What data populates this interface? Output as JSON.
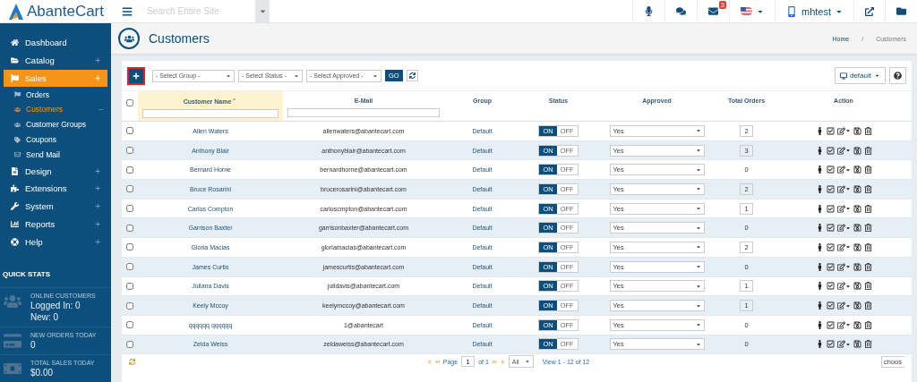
{
  "brand": "AbanteCart",
  "search": {
    "placeholder": "Search Entire Site"
  },
  "topbar": {
    "mail_badge": "3",
    "user": "mhtest"
  },
  "sidebar": {
    "items": [
      {
        "kind": "home",
        "label": "Dashboard",
        "selected": false
      },
      {
        "kind": "folder",
        "label": "Catalog",
        "selected": false,
        "toggle": "+"
      },
      {
        "kind": "flag",
        "label": "Sales",
        "selected": true,
        "toggle": "+",
        "children": [
          {
            "kind": "flag",
            "label": "Orders",
            "selected": false
          },
          {
            "kind": "users",
            "label": "Customers",
            "selected": true,
            "toggle": "−"
          },
          {
            "kind": "users",
            "label": "Customer Groups",
            "selected": false
          },
          {
            "kind": "tag",
            "label": "Coupons",
            "selected": false
          },
          {
            "kind": "mail",
            "label": "Send Mail",
            "selected": false
          }
        ]
      },
      {
        "kind": "file",
        "label": "Design",
        "selected": false,
        "toggle": "+"
      },
      {
        "kind": "puzzle",
        "label": "Extensions",
        "selected": false,
        "toggle": "+"
      },
      {
        "kind": "wrench",
        "label": "System",
        "selected": false,
        "toggle": "+"
      },
      {
        "kind": "chart",
        "label": "Reports",
        "selected": false,
        "toggle": "+"
      },
      {
        "kind": "help",
        "label": "Help",
        "selected": false,
        "toggle": "+"
      }
    ],
    "quick_stats": {
      "title": "QUICK STATS",
      "stats": [
        {
          "kind": "users",
          "label": "ONLINE CUSTOMERS",
          "lines": [
            "Logged In: 0",
            "New: 0"
          ]
        },
        {
          "kind": "card",
          "label": "NEW ORDERS TODAY",
          "lines": [
            "0"
          ]
        },
        {
          "kind": "money",
          "label": "TOTAL SALES TODAY",
          "lines": [
            "$0.00"
          ]
        }
      ]
    }
  },
  "page": {
    "title": "Customers",
    "breadcrumb": [
      "Home",
      "Customers"
    ],
    "separator": "/"
  },
  "toolbar": {
    "filters": [
      "- Select Group -",
      "- Select Status -",
      "- Select Approved -"
    ],
    "go": "GO",
    "view": "default"
  },
  "table": {
    "select_all_checked": false,
    "columns": [
      {
        "label": "Customer Name",
        "sorted": true,
        "filter": true
      },
      {
        "label": "E-Mail",
        "sorted": false,
        "filter": true
      },
      {
        "label": "Group",
        "sorted": false,
        "filter": false
      },
      {
        "label": "Status",
        "sorted": false,
        "filter": false
      },
      {
        "label": "Approved",
        "sorted": false,
        "filter": false
      },
      {
        "label": "Total Orders",
        "sorted": false,
        "filter": false
      },
      {
        "label": "Action",
        "sorted": false,
        "filter": false
      }
    ],
    "rows": [
      {
        "name": "Allen Waters",
        "email": "allenwaters@abantecart.com",
        "group": "Default",
        "on_label": "ON",
        "off_label": "OFF",
        "status_on": true,
        "approved": "Yes",
        "orders": "2",
        "orders_linked": true,
        "checked": false
      },
      {
        "name": "Anthony Blair",
        "email": "anthonyblair@abantecart.com",
        "group": "Default",
        "on_label": "ON",
        "off_label": "OFF",
        "status_on": true,
        "approved": "Yes",
        "orders": "3",
        "orders_linked": true,
        "checked": false
      },
      {
        "name": "Bernard Horne",
        "email": "bernardhorne@abantecart.com",
        "group": "Default",
        "on_label": "ON",
        "off_label": "OFF",
        "status_on": true,
        "approved": "Yes",
        "orders": "0",
        "orders_linked": false,
        "checked": false
      },
      {
        "name": "Bruce Rosarini",
        "email": "brucerosarini@abantecart.com",
        "group": "Default",
        "on_label": "ON",
        "off_label": "OFF",
        "status_on": true,
        "approved": "Yes",
        "orders": "2",
        "orders_linked": true,
        "checked": false
      },
      {
        "name": "Carlos Compton",
        "email": "carloscmpton@abantecart.com",
        "group": "Default",
        "on_label": "ON",
        "off_label": "OFF",
        "status_on": true,
        "approved": "Yes",
        "orders": "1",
        "orders_linked": true,
        "checked": false
      },
      {
        "name": "Garrison Baxter",
        "email": "garrisonbaxter@abantecart.com",
        "group": "Default",
        "on_label": "ON",
        "off_label": "OFF",
        "status_on": true,
        "approved": "Yes",
        "orders": "0",
        "orders_linked": false,
        "checked": false
      },
      {
        "name": "Gloria Macias",
        "email": "gloriamacias@abantecart.com",
        "group": "Default",
        "on_label": "ON",
        "off_label": "OFF",
        "status_on": true,
        "approved": "Yes",
        "orders": "2",
        "orders_linked": true,
        "checked": false
      },
      {
        "name": "James Curtis",
        "email": "jamescurtis@abantecart.com",
        "group": "Default",
        "on_label": "ON",
        "off_label": "OFF",
        "status_on": true,
        "approved": "Yes",
        "orders": "0",
        "orders_linked": false,
        "checked": false
      },
      {
        "name": "Juliana Davis",
        "email": "julidavis@abantecart.com",
        "group": "Default",
        "on_label": "ON",
        "off_label": "OFF",
        "status_on": true,
        "approved": "Yes",
        "orders": "1",
        "orders_linked": true,
        "checked": false
      },
      {
        "name": "Keely Mccoy",
        "email": "keelymccoy@abantecart.com",
        "group": "Default",
        "on_label": "ON",
        "off_label": "OFF",
        "status_on": true,
        "approved": "Yes",
        "orders": "1",
        "orders_linked": true,
        "checked": false
      },
      {
        "name": "qqqqqq qqqqqq",
        "email": "1@abantecart",
        "group": "Default",
        "on_label": "ON",
        "off_label": "OFF",
        "status_on": true,
        "approved": "Yes",
        "orders": "0",
        "orders_linked": false,
        "checked": false
      },
      {
        "name": "Zelda Weiss",
        "email": "zeldaweiss@abantecart.com",
        "group": "Default",
        "on_label": "ON",
        "off_label": "OFF",
        "status_on": true,
        "approved": "Yes",
        "orders": "0",
        "orders_linked": false,
        "checked": false
      }
    ]
  },
  "pager": {
    "page_label": "Page",
    "page": "1",
    "of": "of 1",
    "rows": "All",
    "view": "View 1 - 12 of 12",
    "choose": "choos"
  }
}
